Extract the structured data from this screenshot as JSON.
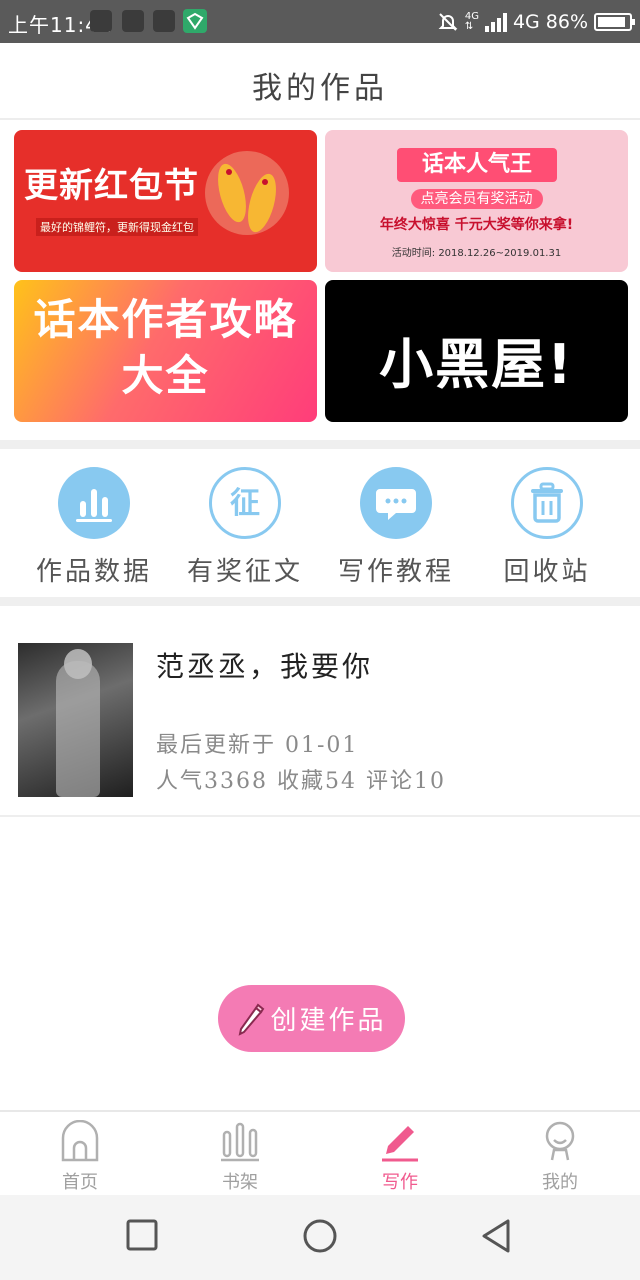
{
  "status_bar": {
    "time": "上午11:41",
    "network_small": "4G",
    "network": "4G",
    "battery": "86%",
    "battery_level": 0.86
  },
  "header": {
    "title": "我的作品"
  },
  "banners": [
    {
      "headline": "更新红包节",
      "sub": "最好的锦鲤符，更新得现金红包"
    },
    {
      "title": "话本人气王",
      "tagline": "点亮会员有奖活动",
      "prize": "年终大惊喜 千元大奖等你来拿!",
      "date": "活动时间: 2018.12.26~2019.01.31"
    },
    {
      "text_line1": "话本作者攻略",
      "text_line2": "大全"
    },
    {
      "text": "小黑屋!"
    }
  ],
  "tools": [
    {
      "label": "作品数据",
      "icon": "bar-chart-icon"
    },
    {
      "label": "有奖征文",
      "icon": "zheng-badge-icon",
      "glyph": "征"
    },
    {
      "label": "写作教程",
      "icon": "chat-bubble-icon"
    },
    {
      "label": "回收站",
      "icon": "trash-icon"
    }
  ],
  "work": {
    "title": "范丞丞，我要你",
    "updated": "最后更新于 01-01",
    "stats": "人气3368 收藏54 评论10"
  },
  "create_button": {
    "label": "创建作品"
  },
  "bottom_nav": [
    {
      "label": "首页",
      "icon": "home-icon",
      "active": false
    },
    {
      "label": "书架",
      "icon": "bookshelf-icon",
      "active": false
    },
    {
      "label": "写作",
      "icon": "pencil-icon",
      "active": true
    },
    {
      "label": "我的",
      "icon": "profile-icon",
      "active": false
    }
  ],
  "colors": {
    "accent_blue": "#88c9f0",
    "accent_pink": "#f47bb4",
    "active_nav": "#f05a8e"
  }
}
